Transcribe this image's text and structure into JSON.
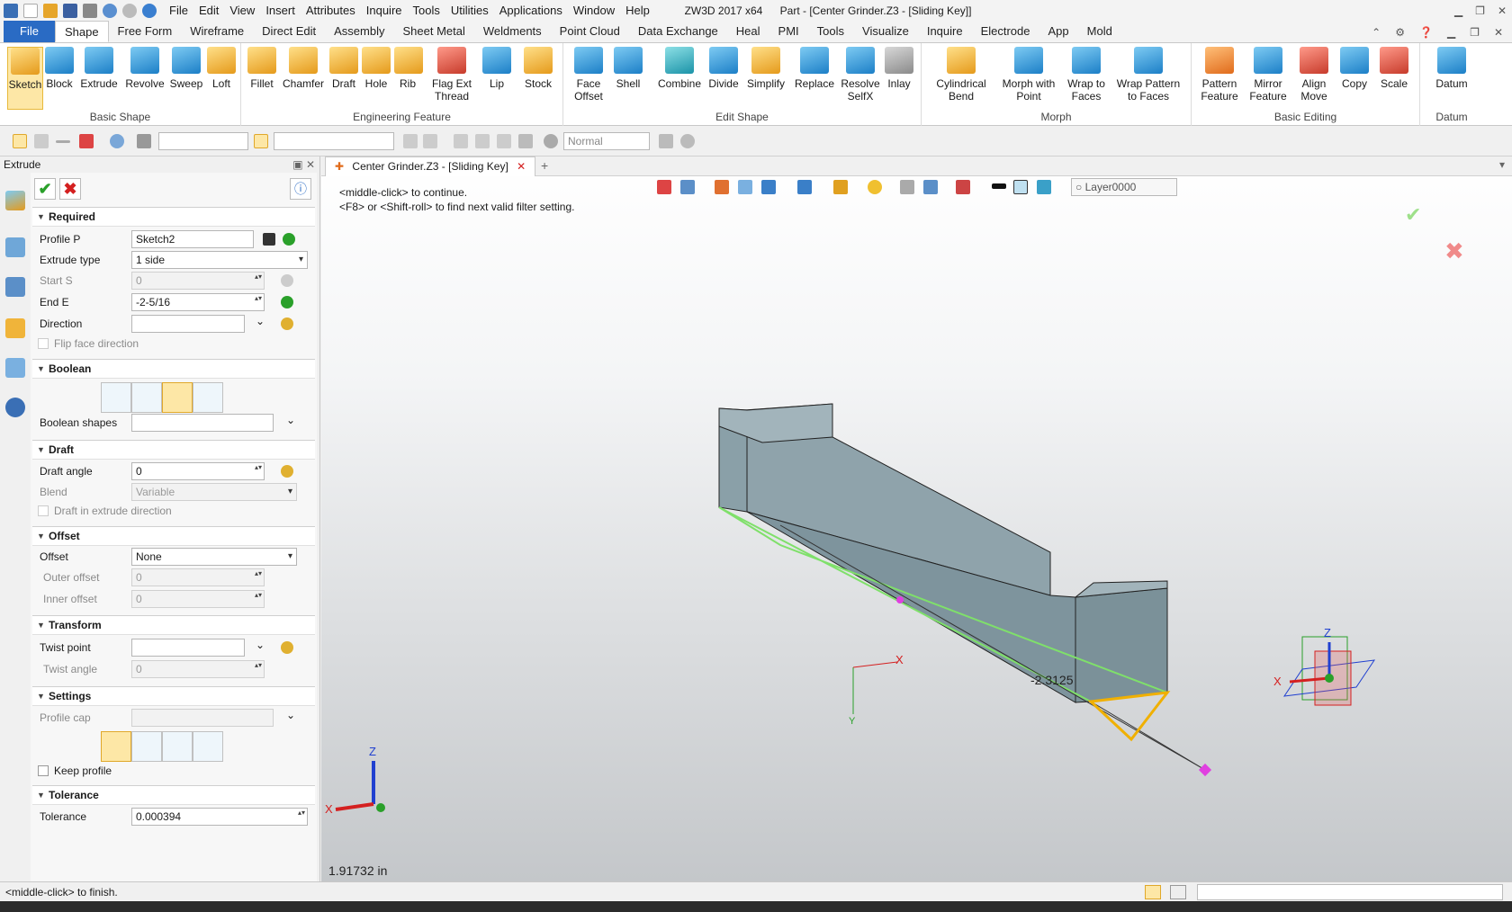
{
  "app": {
    "title_product": "ZW3D 2017  x64",
    "title_doc": "Part - [Center Grinder.Z3 - [Sliding Key]]",
    "menu": [
      "File",
      "Edit",
      "View",
      "Insert",
      "Attributes",
      "Inquire",
      "Tools",
      "Utilities",
      "Applications",
      "Window",
      "Help"
    ]
  },
  "ribbon": {
    "tabs": [
      "File",
      "Shape",
      "Free Form",
      "Wireframe",
      "Direct Edit",
      "Assembly",
      "Sheet Metal",
      "Weldments",
      "Point Cloud",
      "Data Exchange",
      "Heal",
      "PMI",
      "Tools",
      "Visualize",
      "Inquire",
      "Electrode",
      "App",
      "Mold"
    ],
    "active_tab": "Shape",
    "groups": {
      "basic_shape": {
        "name": "Basic Shape",
        "buttons": [
          "Sketch",
          "Block",
          "Extrude",
          "Revolve",
          "Sweep",
          "Loft"
        ]
      },
      "engineering_feature": {
        "name": "Engineering Feature",
        "buttons": [
          "Fillet",
          "Chamfer",
          "Draft",
          "Hole",
          "Rib",
          "Flag Ext Thread",
          "Lip",
          "Stock"
        ]
      },
      "edit_shape": {
        "name": "Edit Shape",
        "buttons": [
          "Face Offset",
          "Shell",
          "Combine",
          "Divide",
          "Simplify",
          "Replace",
          "Resolve SelfX",
          "Inlay"
        ]
      },
      "morph": {
        "name": "Morph",
        "buttons": [
          "Cylindrical Bend",
          "Morph with Point",
          "Wrap to Faces",
          "Wrap Pattern to Faces"
        ]
      },
      "basic_editing": {
        "name": "Basic Editing",
        "buttons": [
          "Pattern Feature",
          "Mirror Feature",
          "Align Move",
          "Copy",
          "Scale"
        ]
      },
      "datum": {
        "name": "Datum",
        "buttons": [
          "Datum"
        ]
      }
    }
  },
  "toolbar": {
    "render_mode": "Normal"
  },
  "panel": {
    "title": "Extrude",
    "sections": {
      "required": "Required",
      "boolean": "Boolean",
      "draft": "Draft",
      "offset": "Offset",
      "transform": "Transform",
      "settings": "Settings",
      "tolerance": "Tolerance"
    },
    "fields": {
      "profile_label": "Profile P",
      "profile_value": "Sketch2",
      "extrude_type_label": "Extrude type",
      "extrude_type_value": "1 side",
      "start_label": "Start S",
      "start_value": "0",
      "end_label": "End E",
      "end_value": "-2-5/16",
      "direction_label": "Direction",
      "flip_label": "Flip face direction",
      "boolean_shapes_label": "Boolean shapes",
      "draft_angle_label": "Draft angle",
      "draft_angle_value": "0",
      "blend_label": "Blend",
      "blend_value": "Variable",
      "draft_extrude_label": "Draft in extrude direction",
      "offset_label": "Offset",
      "offset_value": "None",
      "outer_offset_label": "Outer offset",
      "outer_offset_value": "0",
      "inner_offset_label": "Inner offset",
      "inner_offset_value": "0",
      "twist_point_label": "Twist point",
      "twist_angle_label": "Twist angle",
      "twist_angle_value": "0",
      "profile_cap_label": "Profile cap",
      "keep_profile_label": "Keep profile",
      "tolerance_label": "Tolerance",
      "tolerance_value": "0.000394"
    }
  },
  "viewport": {
    "doc_tab": "Center Grinder.Z3 - [Sliding Key]",
    "layer": "Layer0000",
    "hint1": "<middle-click> to continue.",
    "hint2": "<F8> or <Shift-roll> to find next valid filter setting.",
    "dimension": "-2.3125",
    "measure": "1.91732 in",
    "axis_x": "X",
    "axis_y": "Y",
    "axis_z": "Z"
  },
  "status": {
    "text": "<middle-click> to finish."
  }
}
